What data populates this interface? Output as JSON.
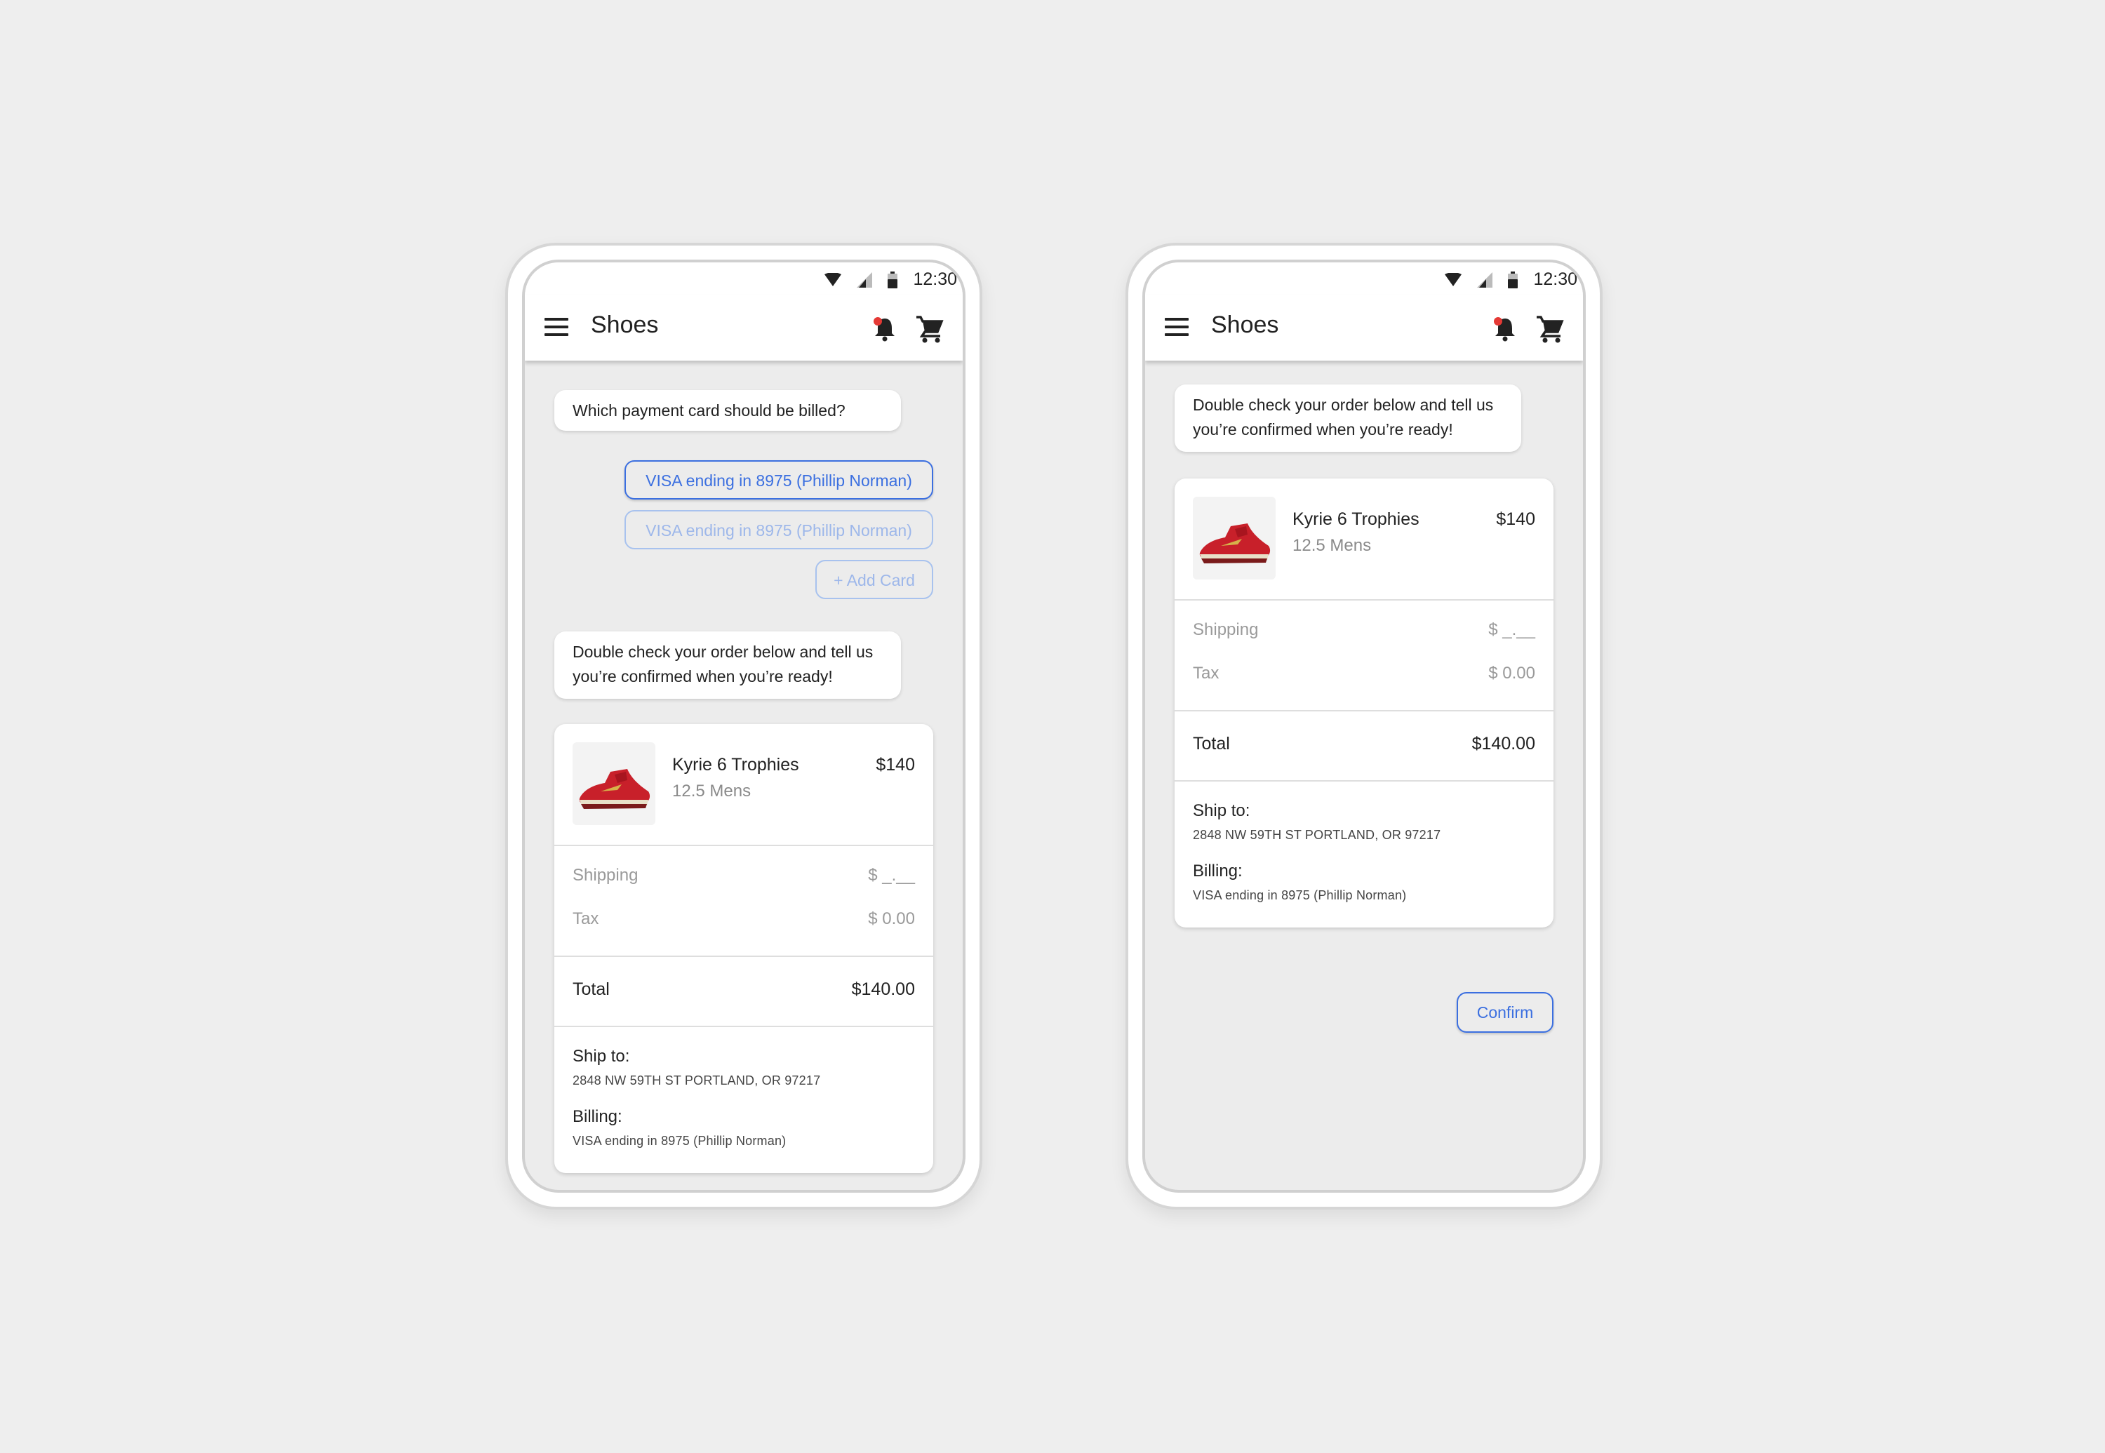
{
  "colors": {
    "accent": "#3b6fe0",
    "accent_muted": "#9db7ea",
    "background": "#eeeeee",
    "notification_dot": "#e53935"
  },
  "status_bar": {
    "time": "12:30"
  },
  "app_bar": {
    "title": "Shoes",
    "icons": [
      "menu-icon",
      "notification-bell-icon",
      "shopping-cart-icon"
    ]
  },
  "screen1": {
    "question": "Which payment card should be billed?",
    "card_options": [
      {
        "label": "VISA ending in 8975 (Phillip Norman)",
        "state": "selected"
      },
      {
        "label": "VISA ending in 8975 (Phillip Norman)",
        "state": "unselected"
      }
    ],
    "add_card_label": "+ Add Card",
    "confirm_prompt": "Double check your order below and tell us you’re confirmed when you’re ready!"
  },
  "screen2": {
    "confirm_prompt": "Double check your order below and tell us you’re confirmed when you’re ready!",
    "confirm_label": "Confirm"
  },
  "order": {
    "product_name": "Kyrie 6 Trophies",
    "product_size": "12.5 Mens",
    "product_price": "$140",
    "shipping_label": "Shipping",
    "shipping_value": "$ _.__",
    "tax_label": "Tax",
    "tax_value": "$ 0.00",
    "total_label": "Total",
    "total_value": "$140.00",
    "ship_to_label": "Ship to:",
    "ship_to_address": "2848 NW 59TH ST PORTLAND, OR 97217",
    "billing_label": "Billing:",
    "billing_value": "VISA ending in 8975 (Phillip Norman)"
  }
}
